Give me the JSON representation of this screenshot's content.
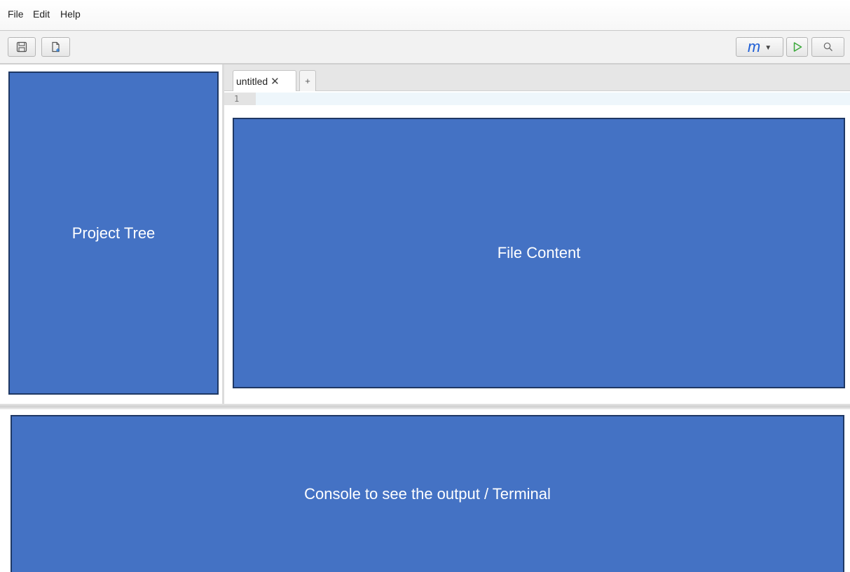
{
  "menubar": {
    "items": [
      {
        "label": "File"
      },
      {
        "label": "Edit"
      },
      {
        "label": "Help"
      }
    ]
  },
  "toolbar": {
    "save_icon": "save-icon",
    "new_file_icon": "new-file-icon",
    "language_label": "m",
    "run_icon": "play-icon",
    "search_icon": "search-icon"
  },
  "editor": {
    "tabs": [
      {
        "label": "untitled",
        "close": "✕"
      }
    ],
    "add_tab_label": "+",
    "line_number": "1"
  },
  "placeholders": {
    "project_tree": "Project Tree",
    "file_content": "File Content",
    "console": "Console to see the output / Terminal"
  },
  "colors": {
    "placeholder_fill": "#4472c4",
    "placeholder_border": "#1f3864",
    "run_green": "#3aa83a",
    "language_blue": "#1f5fd6"
  }
}
